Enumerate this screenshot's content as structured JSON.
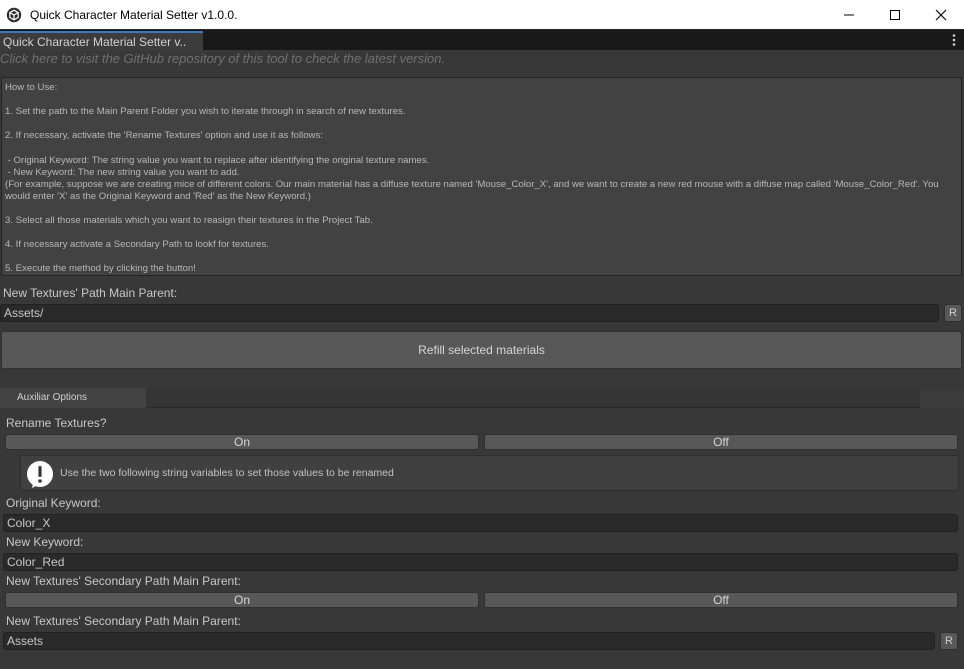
{
  "window": {
    "title": "Quick Character Material Setter v1.0.0."
  },
  "tab": {
    "label": "Quick Character Material Setter v.."
  },
  "github_link": "Click here to visit the GitHub repository of this tool to check the latest version.",
  "howto": {
    "text": "How to Use:\n\n1. Set the path to the Main Parent Folder you wish to iterate through in search of new textures.\n\n2. If necessary, activate the 'Rename Textures' option and use it as follows:\n\n - Original Keyword: The string value you want to replace after identifying the original texture names.\n - New Keyword: The new string value you want to add.\n(For example, suppose we are creating mice of different colors. Our main material has a diffuse texture named 'Mouse_Color_X', and we want to create a new red mouse with a diffuse map called 'Mouse_Color_Red'. You would enter 'X' as the Original Keyword and 'Red' as the New Keyword.)\n\n3. Select all those materials which you want to reasign their textures in the Project Tab.\n\n4. If necessary activate a Secondary Path to lookf for textures.\n\n5. Execute the method by clicking the button!"
  },
  "main_path": {
    "label": "New Textures' Path Main Parent:",
    "value": "Assets/",
    "reset": "R"
  },
  "refill_button": "Refill selected materials",
  "aux": {
    "tab_label": "Auxiliar Options"
  },
  "rename": {
    "label": "Rename Textures?",
    "on": "On",
    "off": "Off",
    "help": "Use the two following string variables to set those values to be renamed"
  },
  "original_keyword": {
    "label": "Original Keyword:",
    "value": "Color_X"
  },
  "new_keyword": {
    "label": "New Keyword:",
    "value": "Color_Red"
  },
  "secondary_toggle": {
    "label": "New Textures' Secondary Path Main Parent:",
    "on": "On",
    "off": "Off"
  },
  "secondary_path": {
    "label": "New Textures' Secondary Path Main Parent:",
    "value": "Assets",
    "reset": "R"
  },
  "icons": {
    "app": "unity-logo-icon",
    "warning": "warning-icon"
  }
}
